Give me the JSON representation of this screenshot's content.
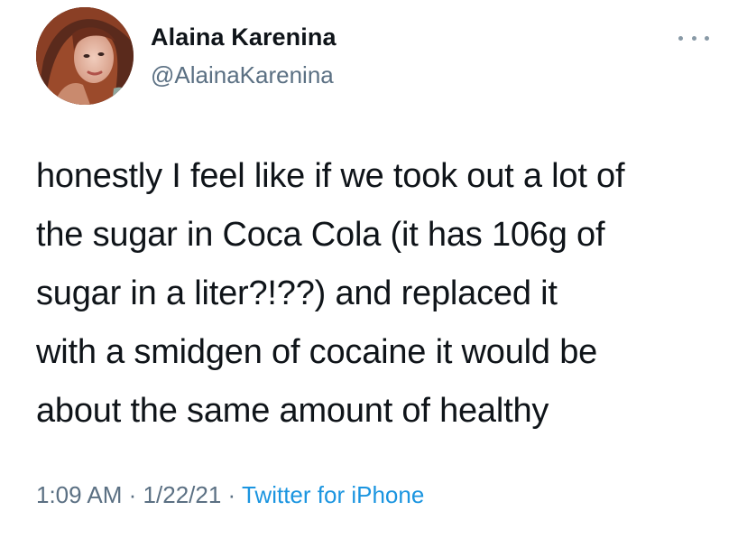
{
  "user": {
    "display_name": "Alaina Karenina",
    "handle": "@AlainaKarenina"
  },
  "tweet": {
    "lines": [
      "honestly I feel like if we took out a lot of",
      "the sugar in Coca Cola (it has 106g of",
      "sugar in a liter?!??) and replaced it",
      "with a smidgen of cocaine it would be",
      "about the same amount of healthy"
    ],
    "time": "1:09 AM",
    "separator": "·",
    "date": "1/22/21",
    "source": "Twitter for iPhone"
  },
  "icons": {
    "more": "more-horizontal-icon"
  },
  "colors": {
    "text": "#0f1419",
    "secondary": "#5b7083",
    "link": "#1b95e0"
  }
}
